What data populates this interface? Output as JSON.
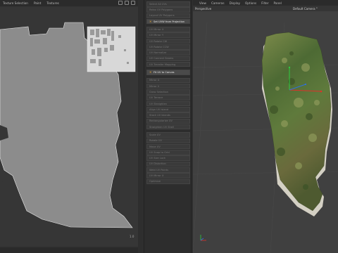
{
  "uv_editor": {
    "menu": [
      "Texture Selection",
      "Paint",
      "Textures"
    ],
    "scale_label": "1.0"
  },
  "commands": [
    {
      "label": "Select All UVs",
      "active": false
    },
    {
      "label": "Relax UV Polygons",
      "active": false
    },
    {
      "label": "Layout UV Polygons",
      "active": false
    },
    {
      "label": "Set UVW from Projection",
      "active": true,
      "checked": true
    },
    {
      "label": "UV Mirror X",
      "active": false
    },
    {
      "label": "UV Mirror Y",
      "active": false
    },
    {
      "label": "UV Rotate CW",
      "active": false
    },
    {
      "label": "UV Rotate CCW",
      "active": false
    },
    {
      "label": "UV Normalize",
      "active": false
    },
    {
      "label": "UV Connect Seams",
      "active": false
    },
    {
      "label": "UV Transfer Mapping",
      "active": false
    },
    {
      "label": "Fit UV to Canvas",
      "active": true,
      "checked": true
    },
    {
      "label": "Mirror U",
      "active": false
    },
    {
      "label": "Mirror V",
      "active": false
    },
    {
      "label": "Grow Selection",
      "active": false
    },
    {
      "label": "UV Terrace",
      "active": false
    },
    {
      "label": "UV Straighten",
      "active": false
    },
    {
      "label": "Align UV Island",
      "active": false
    },
    {
      "label": "Stack UV Islands",
      "active": false
    },
    {
      "label": "Rectangularize UV",
      "active": false
    },
    {
      "label": "Straighten UV Shell",
      "active": false
    },
    {
      "label": "Scale UV",
      "active": false
    },
    {
      "label": "Rotate UV",
      "active": false
    },
    {
      "label": "Move UV",
      "active": false
    },
    {
      "label": "UV Snap to Grid",
      "active": false
    },
    {
      "label": "UV Size Lock",
      "active": false
    },
    {
      "label": "UV Distortion",
      "active": false
    },
    {
      "label": "Weld UV Points",
      "active": false
    },
    {
      "label": "UV Mirror X",
      "active": false
    },
    {
      "label": "Optimize",
      "active": false
    }
  ],
  "viewport": {
    "menu": [
      "View",
      "Cameras",
      "Display",
      "Options",
      "Filter",
      "Panel"
    ],
    "view_name": "Perspective",
    "camera_name": "Default Camera °"
  }
}
